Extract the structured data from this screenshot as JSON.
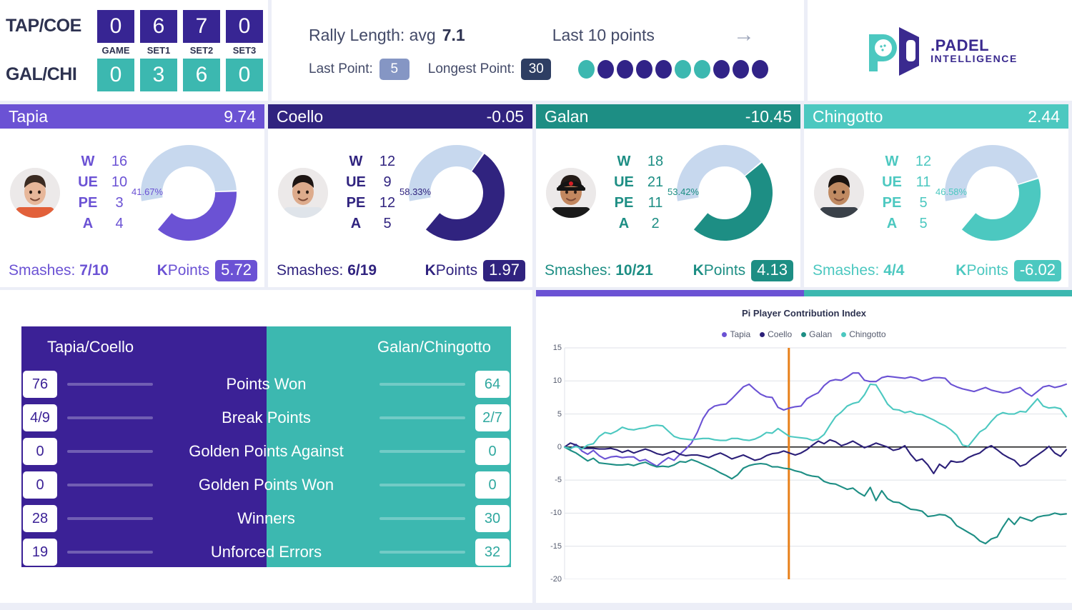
{
  "scoreboard": {
    "team1": "TAP/COE",
    "team2": "GAL/CHI",
    "column_labels": [
      "GAME",
      "SET1",
      "SET2",
      "SET3"
    ],
    "team1_scores": [
      "0",
      "6",
      "7",
      "0"
    ],
    "team2_scores": [
      "0",
      "3",
      "6",
      "0"
    ],
    "team1_color": "#372593",
    "team2_color": "#3cb8b0"
  },
  "rally": {
    "title": "Rally Length: avg",
    "avg": "7.1",
    "last_point_label": "Last Point:",
    "last_point_value": "5",
    "longest_point_label": "Longest Point:",
    "longest_point_value": "30",
    "last10_label": "Last 10 points",
    "arrow_icon": "arrow-right-icon",
    "last10_dots": [
      "teal",
      "purple",
      "purple",
      "purple",
      "purple",
      "teal",
      "teal",
      "purple",
      "purple",
      "purple"
    ]
  },
  "logo": {
    "line1": ".PADEL",
    "line2": "INTELLIGENCE"
  },
  "players": [
    {
      "name": "Tapia",
      "index": "9.74",
      "accent": "#6b52d4",
      "head_bg": "#6b52d4",
      "stats": [
        {
          "key": "W",
          "value": "16"
        },
        {
          "key": "UE",
          "value": "10"
        },
        {
          "key": "PE",
          "value": "3"
        },
        {
          "key": "A",
          "value": "4"
        }
      ],
      "donut_pct": "41.67%",
      "donut_value": 41.67,
      "smashes_label": "Smashes:",
      "smashes_value": "7/10",
      "kpoints_label": "KPoints",
      "kpoints_value": "5.72"
    },
    {
      "name": "Coello",
      "index": "-0.05",
      "accent": "#30237f",
      "head_bg": "#30237f",
      "stats": [
        {
          "key": "W",
          "value": "12"
        },
        {
          "key": "UE",
          "value": "9"
        },
        {
          "key": "PE",
          "value": "12"
        },
        {
          "key": "A",
          "value": "5"
        }
      ],
      "donut_pct": "58.33%",
      "donut_value": 58.33,
      "smashes_label": "Smashes:",
      "smashes_value": "6/19",
      "kpoints_label": "KPoints",
      "kpoints_value": "1.97"
    },
    {
      "name": "Galan",
      "index": "-10.45",
      "accent": "#1d8e84",
      "head_bg": "#1d8e84",
      "stats": [
        {
          "key": "W",
          "value": "18"
        },
        {
          "key": "UE",
          "value": "21"
        },
        {
          "key": "PE",
          "value": "11"
        },
        {
          "key": "A",
          "value": "2"
        }
      ],
      "donut_pct": "53.42%",
      "donut_value": 53.42,
      "smashes_label": "Smashes:",
      "smashes_value": "10/21",
      "kpoints_label": "KPoints",
      "kpoints_value": "4.13"
    },
    {
      "name": "Chingotto",
      "index": "2.44",
      "accent": "#4cc8c0",
      "head_bg": "#4cc8c0",
      "stats": [
        {
          "key": "W",
          "value": "12"
        },
        {
          "key": "UE",
          "value": "11"
        },
        {
          "key": "PE",
          "value": "5"
        },
        {
          "key": "A",
          "value": "5"
        }
      ],
      "donut_pct": "46.58%",
      "donut_value": 46.58,
      "smashes_label": "Smashes:",
      "smashes_value": "4/4",
      "kpoints_label": "KPoints",
      "kpoints_value": "-6.02"
    }
  ],
  "comparison": {
    "left_team": "Tapia/Coello",
    "right_team": "Galan/Chingotto",
    "left_color": "#3b2196",
    "right_color": "#3cb8b0",
    "rows": [
      {
        "label": "Points Won",
        "left": "76",
        "right": "64"
      },
      {
        "label": "Break Points",
        "left": "4/9",
        "right": "2/7"
      },
      {
        "label": "Golden Points Against",
        "left": "0",
        "right": "0"
      },
      {
        "label": "Golden Points Won",
        "left": "0",
        "right": "0"
      },
      {
        "label": "Winners",
        "left": "28",
        "right": "30"
      },
      {
        "label": "Unforced Errors",
        "left": "19",
        "right": "32"
      }
    ]
  },
  "chart_data": {
    "type": "line",
    "title": "Pi Player Contribution Index",
    "xlabel": "",
    "ylabel": "",
    "ylim": [
      -20,
      15
    ],
    "yticks": [
      15,
      10,
      5,
      0,
      -5,
      -10,
      -15,
      -20
    ],
    "grid": true,
    "legend_position": "top",
    "marker_line": {
      "color": "#e8801a",
      "x_fraction": 0.447
    },
    "zero_line": true,
    "series": [
      {
        "name": "Tapia",
        "color": "#6b52d4",
        "values": [
          0,
          -0.3,
          0.4,
          -0.6,
          -1.1,
          -0.5,
          -1.3,
          -1.8,
          -1.5,
          -1.4,
          -1.6,
          -1.5,
          -1.5,
          -2.1,
          -1.9,
          -2.4,
          -2.9,
          -2.2,
          -1.6,
          -2.0,
          -1.1,
          -0.3,
          0.6,
          2.2,
          4.3,
          5.6,
          6.2,
          6.4,
          6.5,
          7.3,
          8.2,
          9.1,
          9.5,
          8.7,
          8.0,
          7.6,
          7.5,
          6.0,
          5.6,
          5.9,
          6.1,
          6.2,
          7.3,
          7.8,
          8.2,
          9.3,
          10.0,
          10.2,
          10.1,
          10.6,
          11.2,
          11.2,
          10.1,
          9.9,
          9.9,
          10.5,
          10.7,
          10.6,
          10.5,
          10.4,
          10.6,
          10.4,
          10.0,
          10.2,
          10.5,
          10.5,
          10.4,
          9.5,
          9.1,
          8.8,
          8.6,
          8.4,
          8.7,
          9.0,
          8.6,
          8.4,
          8.2,
          8.3,
          8.7,
          9.0,
          8.2,
          7.7,
          8.4,
          9.1,
          9.3,
          9.0,
          9.2,
          9.5
        ]
      },
      {
        "name": "Coello",
        "color": "#2b1f78",
        "values": [
          0,
          0.6,
          0.3,
          -0.2,
          -0.2,
          -0.2,
          -0.3,
          -0.3,
          -0.2,
          -0.4,
          -0.8,
          -0.5,
          -0.9,
          -0.6,
          -0.3,
          -0.6,
          -1.0,
          -1.2,
          -0.9,
          -0.6,
          -1.1,
          -1.3,
          -1.2,
          -1.2,
          -1.4,
          -1.6,
          -1.2,
          -0.9,
          -1.3,
          -1.8,
          -1.5,
          -1.2,
          -1.6,
          -2.0,
          -1.8,
          -1.3,
          -1.0,
          -0.9,
          -0.6,
          -0.9,
          -1.2,
          -0.9,
          -0.4,
          0.3,
          0.9,
          0.5,
          1.1,
          0.8,
          0.2,
          0.5,
          0.9,
          0.4,
          -0.1,
          0.2,
          0.6,
          0.3,
          0.0,
          -0.5,
          -0.3,
          0.2,
          -1.1,
          -2.1,
          -1.8,
          -2.7,
          -4.0,
          -2.6,
          -3.2,
          -2.1,
          -2.3,
          -2.2,
          -1.6,
          -1.2,
          -0.9,
          -0.2,
          0.2,
          -0.4,
          -1.1,
          -1.6,
          -2.0,
          -2.9,
          -2.6,
          -1.8,
          -1.2,
          -0.6,
          0.1,
          -0.9,
          -1.4,
          -0.4
        ]
      },
      {
        "name": "Galan",
        "color": "#1d8e84",
        "values": [
          0,
          -0.5,
          -0.9,
          -1.5,
          -2.1,
          -1.7,
          -2.4,
          -2.5,
          -2.6,
          -2.7,
          -2.7,
          -2.6,
          -2.8,
          -2.5,
          -2.3,
          -2.7,
          -3.0,
          -2.9,
          -3.0,
          -2.7,
          -2.2,
          -2.3,
          -1.9,
          -2.2,
          -2.6,
          -3.0,
          -3.4,
          -3.9,
          -4.3,
          -4.8,
          -4.2,
          -3.2,
          -2.8,
          -2.6,
          -2.5,
          -2.6,
          -3.0,
          -3.0,
          -3.2,
          -3.3,
          -3.6,
          -3.8,
          -4.2,
          -4.4,
          -4.5,
          -5.2,
          -5.5,
          -5.6,
          -6.0,
          -6.4,
          -6.2,
          -6.9,
          -7.4,
          -6.1,
          -8.1,
          -6.6,
          -7.8,
          -8.3,
          -8.4,
          -8.9,
          -9.4,
          -9.5,
          -9.7,
          -10.5,
          -10.4,
          -10.2,
          -10.3,
          -10.8,
          -11.9,
          -12.4,
          -12.9,
          -13.4,
          -14.2,
          -14.6,
          -13.9,
          -13.6,
          -12.1,
          -10.8,
          -11.7,
          -10.6,
          -10.9,
          -11.2,
          -10.6,
          -10.4,
          -10.3,
          -10.0,
          -10.2,
          -10.1
        ]
      },
      {
        "name": "Chingotto",
        "color": "#4cc8c0",
        "values": [
          0,
          -0.2,
          0.1,
          -0.3,
          0.3,
          0.5,
          1.6,
          2.2,
          2.0,
          2.4,
          3.0,
          2.7,
          2.6,
          2.8,
          2.9,
          3.2,
          3.3,
          3.2,
          2.4,
          1.6,
          1.3,
          1.2,
          1.1,
          1.2,
          1.3,
          1.3,
          1.1,
          1.0,
          1.0,
          1.3,
          1.3,
          1.1,
          1.0,
          1.2,
          1.6,
          2.2,
          2.1,
          2.8,
          2.2,
          1.6,
          1.5,
          1.4,
          1.3,
          1.0,
          1.2,
          1.9,
          3.3,
          4.6,
          5.3,
          6.2,
          6.6,
          6.8,
          7.9,
          9.5,
          9.4,
          8.0,
          6.5,
          5.7,
          5.6,
          5.2,
          5.4,
          5.0,
          4.9,
          4.5,
          4.1,
          3.6,
          3.2,
          2.6,
          1.8,
          0.3,
          0.1,
          1.2,
          2.3,
          2.8,
          3.9,
          4.8,
          5.2,
          5.0,
          5.0,
          5.4,
          5.3,
          6.3,
          7.3,
          6.2,
          5.9,
          6.0,
          5.8,
          4.6
        ]
      }
    ]
  }
}
